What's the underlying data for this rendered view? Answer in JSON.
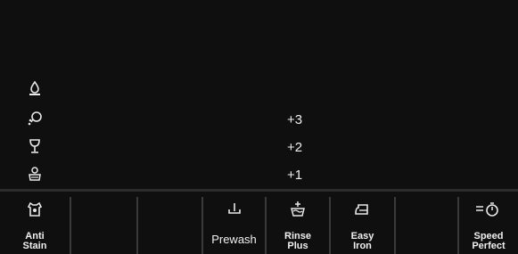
{
  "indicators": [
    {
      "icon": "water-drop-icon"
    },
    {
      "icon": "spin-dots-icon"
    },
    {
      "icon": "wine-glass-icon"
    },
    {
      "icon": "wash-tub-icon"
    }
  ],
  "levels": [
    "+3",
    "+2",
    "+1"
  ],
  "buttons": [
    {
      "label": "Anti\nStain",
      "icon": "anti-stain-icon"
    },
    {
      "label": "",
      "icon": ""
    },
    {
      "label": "",
      "icon": ""
    },
    {
      "label": "Prewash",
      "icon": "prewash-icon"
    },
    {
      "label": "Rinse\nPlus",
      "icon": "rinse-plus-icon"
    },
    {
      "label": "Easy\nIron",
      "icon": "iron-icon"
    },
    {
      "label": "",
      "icon": ""
    },
    {
      "label": "Speed\nPerfect",
      "icon": "speed-perfect-icon"
    }
  ]
}
